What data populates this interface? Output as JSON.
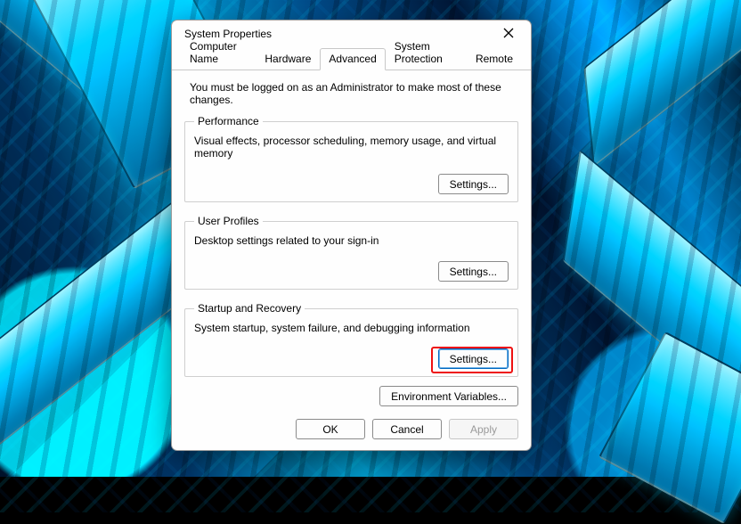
{
  "window": {
    "title": "System Properties"
  },
  "tabs": {
    "computer_name": "Computer Name",
    "hardware": "Hardware",
    "advanced": "Advanced",
    "system_protection": "System Protection",
    "remote": "Remote"
  },
  "admin_note": "You must be logged on as an Administrator to make most of these changes.",
  "performance": {
    "legend": "Performance",
    "desc": "Visual effects, processor scheduling, memory usage, and virtual memory",
    "button": "Settings..."
  },
  "user_profiles": {
    "legend": "User Profiles",
    "desc": "Desktop settings related to your sign-in",
    "button": "Settings..."
  },
  "startup": {
    "legend": "Startup and Recovery",
    "desc": "System startup, system failure, and debugging information",
    "button": "Settings..."
  },
  "env_button": "Environment Variables...",
  "footer": {
    "ok": "OK",
    "cancel": "Cancel",
    "apply": "Apply"
  }
}
